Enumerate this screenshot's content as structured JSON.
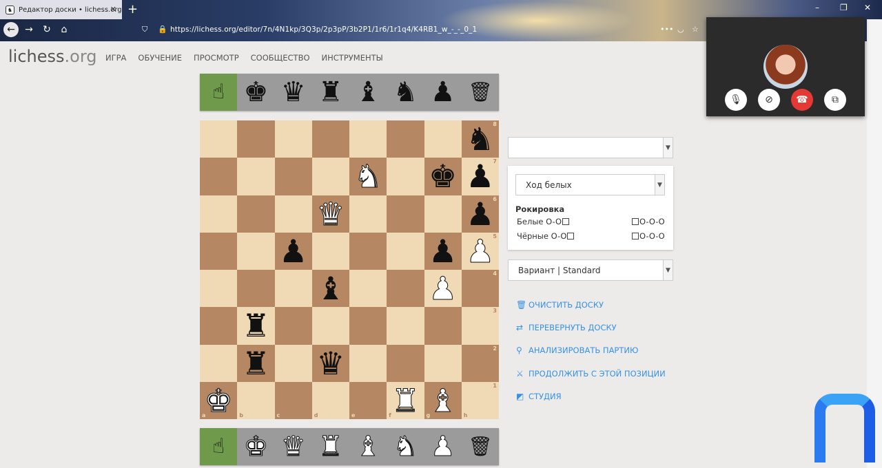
{
  "browser": {
    "tab_title": "Редактор доски • lichess.org",
    "url": "https://lichess.org/editor/7n/4N1kp/3Q3p/2p3pP/3b2P1/1r6/1r1q4/K4RB1_w_-_-_0_1"
  },
  "site": {
    "logo_main": "lichess",
    "logo_suffix": ".org",
    "nav": [
      "ИГРА",
      "ОБУЧЕНИЕ",
      "ПРОСМОТР",
      "СООБЩЕСТВО",
      "ИНСТРУМЕНТЫ"
    ]
  },
  "spare_black": [
    {
      "icon": "pointer-hand-icon",
      "glyph": "☝",
      "selected": true
    },
    {
      "icon": "black-king-icon",
      "glyph": "♚"
    },
    {
      "icon": "black-queen-icon",
      "glyph": "♛"
    },
    {
      "icon": "black-rook-icon",
      "glyph": "♜"
    },
    {
      "icon": "black-bishop-icon",
      "glyph": "♝"
    },
    {
      "icon": "black-knight-icon",
      "glyph": "♞"
    },
    {
      "icon": "black-pawn-icon",
      "glyph": "♟"
    },
    {
      "icon": "trash-icon",
      "glyph": "🗑"
    }
  ],
  "spare_white": [
    {
      "icon": "pointer-hand-icon",
      "glyph": "☝",
      "selected": true
    },
    {
      "icon": "white-king-icon",
      "glyph": "♚"
    },
    {
      "icon": "white-queen-icon",
      "glyph": "♛"
    },
    {
      "icon": "white-rook-icon",
      "glyph": "♜"
    },
    {
      "icon": "white-bishop-icon",
      "glyph": "♝"
    },
    {
      "icon": "white-knight-icon",
      "glyph": "♞"
    },
    {
      "icon": "white-pawn-icon",
      "glyph": "♟"
    },
    {
      "icon": "trash-icon",
      "glyph": "🗑"
    }
  ],
  "board": {
    "files": [
      "a",
      "b",
      "c",
      "d",
      "e",
      "f",
      "g",
      "h"
    ],
    "ranks": [
      "8",
      "7",
      "6",
      "5",
      "4",
      "3",
      "2",
      "1"
    ],
    "position": [
      [
        "",
        "",
        "",
        "",
        "",
        "",
        "",
        "bN"
      ],
      [
        "",
        "",
        "",
        "",
        "wN",
        "",
        "bK",
        "bP"
      ],
      [
        "",
        "",
        "",
        "wQ",
        "",
        "",
        "",
        "bP"
      ],
      [
        "",
        "",
        "bP",
        "",
        "",
        "",
        "bP",
        "wP"
      ],
      [
        "",
        "",
        "",
        "bB",
        "",
        "",
        "wP",
        ""
      ],
      [
        "",
        "bR",
        "",
        "",
        "",
        "",
        "",
        ""
      ],
      [
        "",
        "bR",
        "",
        "bQ",
        "",
        "",
        "",
        ""
      ],
      [
        "wK",
        "",
        "",
        "",
        "",
        "wR",
        "wB",
        ""
      ]
    ]
  },
  "panel": {
    "opening_select": "",
    "turn_select": "Ход белых",
    "castling_title": "Рокировка",
    "white_oo": "Белые O-O",
    "white_ooo": "O-O-O",
    "black_oo": "Чёрные O-O",
    "black_ooo": "O-O-O",
    "variant_select": "Вариант | Standard"
  },
  "actions": [
    {
      "label": "ОЧИСТИТЬ ДОСКУ",
      "icon": "trash-icon",
      "glyph": "🗑"
    },
    {
      "label": "ПЕРЕВЕРНУТЬ ДОСКУ",
      "icon": "flip-icon",
      "glyph": "⇄"
    },
    {
      "label": "АНАЛИЗИРОВАТЬ ПАРТИЮ",
      "icon": "microscope-icon",
      "glyph": "⚲"
    },
    {
      "label": "ПРОДОЛЖИТЬ С ЭТОЙ ПОЗИЦИИ",
      "icon": "swords-icon",
      "glyph": "⚔"
    },
    {
      "label": "СТУДИЯ",
      "icon": "study-icon",
      "glyph": "◩"
    }
  ],
  "colors": {
    "light_square": "#f0d9b5",
    "dark_square": "#b58863",
    "selected_tool": "#6f9a4b",
    "action_link": "#3692e7",
    "hangup": "#e53935"
  }
}
